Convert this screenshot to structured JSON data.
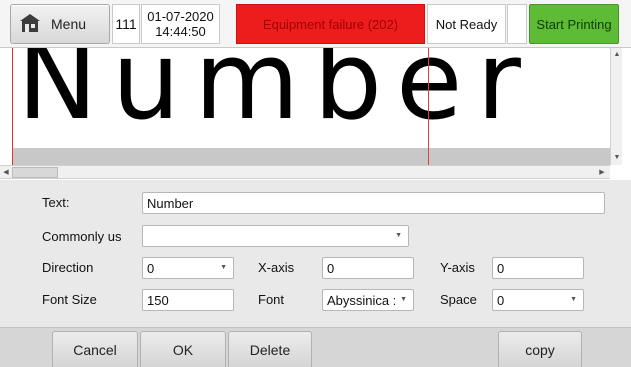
{
  "header": {
    "menu_label": "Menu",
    "menu_icon": "home-icon",
    "counter": "111",
    "date": "01-07-2020",
    "time": "14:44:50",
    "fault_text": "Equipment failure (202)",
    "status_text": "Not Ready",
    "start_label": "Start Printing"
  },
  "preview": {
    "text": "Number"
  },
  "form": {
    "text_label": "Text:",
    "text_value": "Number",
    "common_label": "Commonly us",
    "common_value": "",
    "direction_label": "Direction",
    "direction_value": "0",
    "xaxis_label": "X-axis",
    "xaxis_value": "0",
    "yaxis_label": "Y-axis",
    "yaxis_value": "0",
    "fontsize_label": "Font Size",
    "fontsize_value": "150",
    "font_label": "Font",
    "font_value": "Abyssinica :",
    "space_label": "Space",
    "space_value": "0"
  },
  "buttons": {
    "cancel": "Cancel",
    "ok": "OK",
    "delete": "Delete",
    "copy": "copy"
  },
  "colors": {
    "fault_bg": "#ee1d1d",
    "start_bg": "#5dbb35",
    "form_bg": "#e9e9e9"
  }
}
